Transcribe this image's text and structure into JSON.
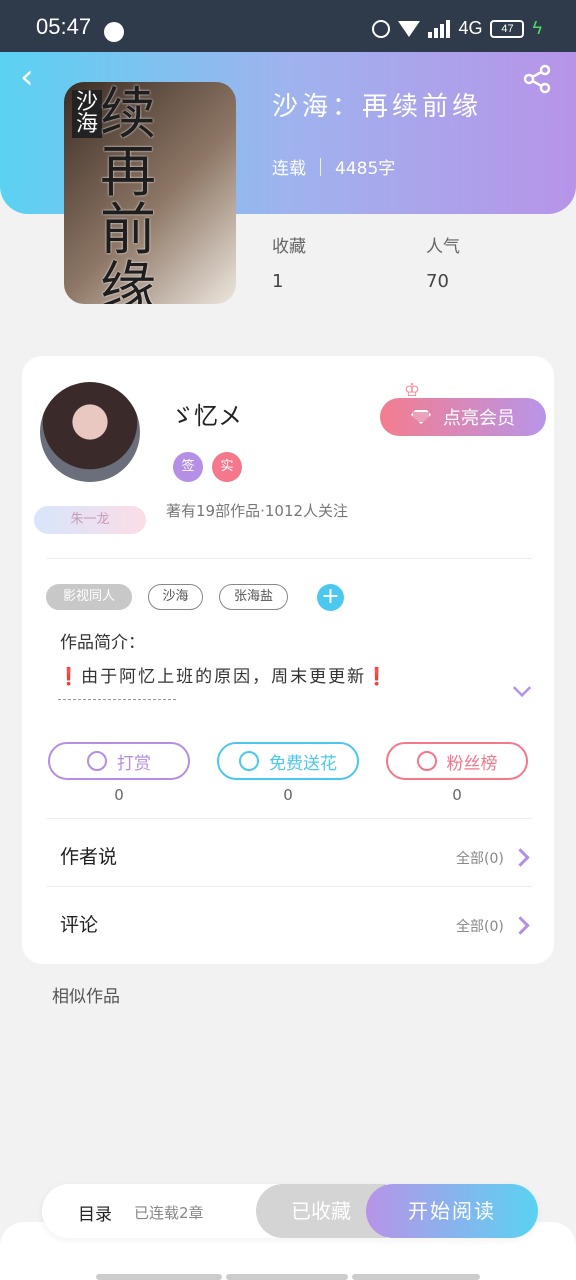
{
  "status_bar": {
    "time": "05:47",
    "network": "4G",
    "battery": "47"
  },
  "book": {
    "title": "沙海：再续前缘",
    "status": "连载",
    "word_count": "4485字",
    "stats": [
      {
        "label": "收藏",
        "value": "1"
      },
      {
        "label": "人气",
        "value": "70"
      }
    ]
  },
  "author": {
    "name": "ゞ忆メ",
    "badges": [
      {
        "text": "签",
        "color": "#b58ee6"
      },
      {
        "text": "实",
        "color": "#f4778c"
      }
    ],
    "vip_button_label": "点亮会员",
    "title_tag": "朱一龙",
    "stats_text": "著有19部作品·1012人关注"
  },
  "tags": [
    "影视同人",
    "沙海",
    "张海盐"
  ],
  "intro": {
    "title": "作品简介：",
    "text": "由于阿忆上班的原因，周末更更新",
    "mark": "❗"
  },
  "actions": [
    {
      "label": "打赏",
      "count": "0",
      "color": "#b58ee6"
    },
    {
      "label": "免费送花",
      "count": "0",
      "color": "#4bc8ef"
    },
    {
      "label": "粉丝榜",
      "count": "0",
      "color": "#f4778c"
    }
  ],
  "rows": [
    {
      "label": "作者说",
      "right": "全部(0)"
    },
    {
      "label": "评论",
      "right": "全部(0)"
    }
  ],
  "similar_title": "相似作品",
  "bottom": {
    "toc_label": "目录",
    "toc_status": "已连载2章",
    "collect_label": "已收藏",
    "read_label": "开始阅读"
  }
}
